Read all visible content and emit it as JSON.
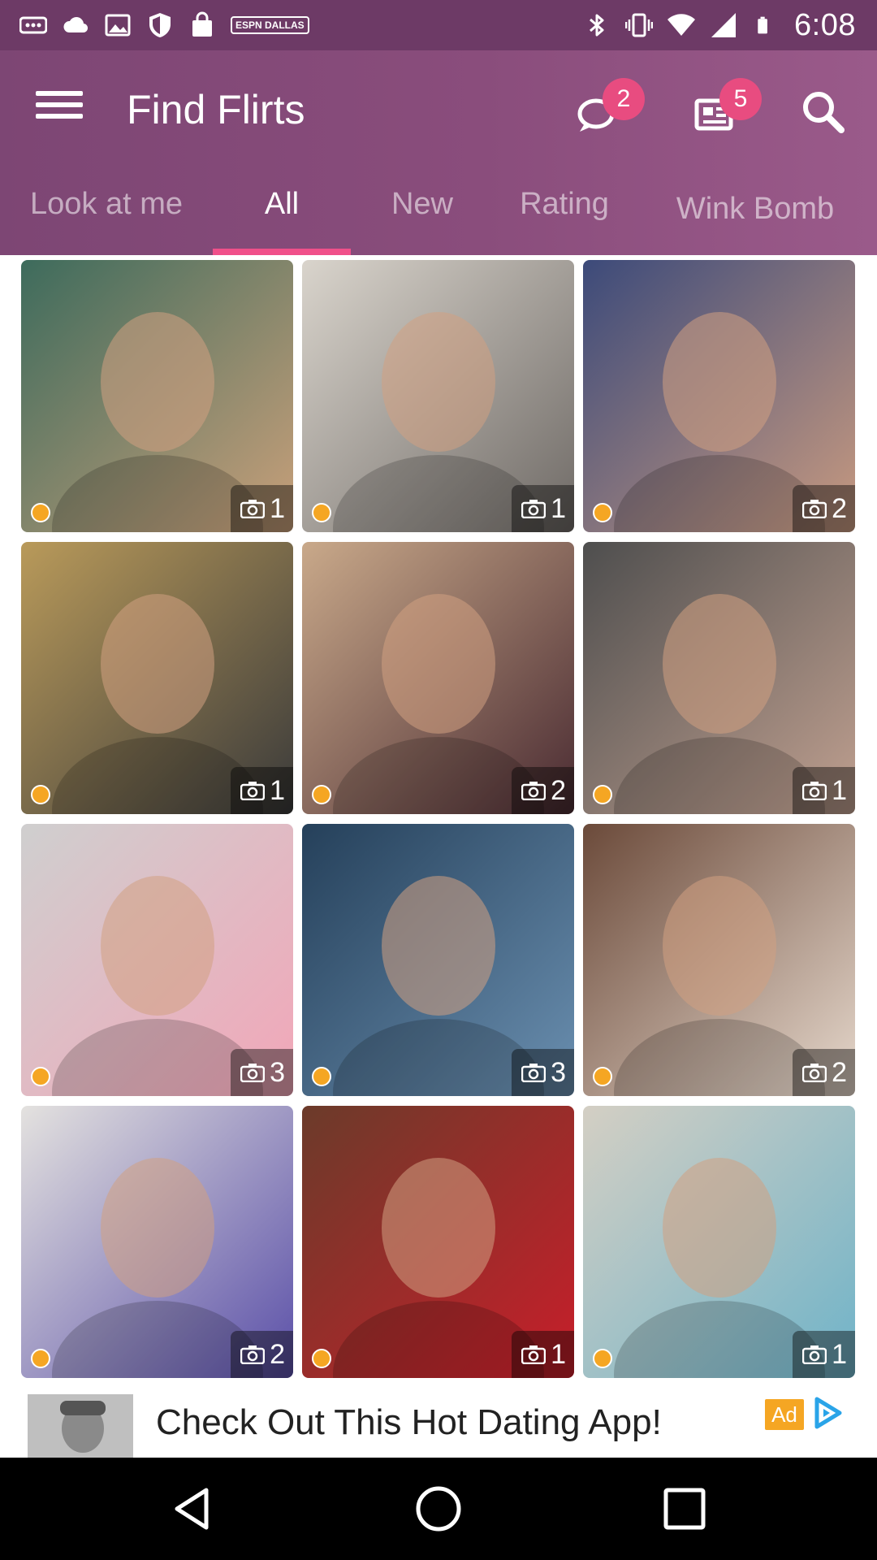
{
  "status_bar": {
    "time": "6:08",
    "left_icons": [
      "notification-dots-icon",
      "cloud-icon",
      "image-icon",
      "shield-icon",
      "shopping-bag-icon",
      "espn-icon"
    ],
    "espn_badge_text": "ESPN DALLAS",
    "right_icons": [
      "bluetooth-icon",
      "vibrate-icon",
      "wifi-icon",
      "signal-icon",
      "battery-icon"
    ]
  },
  "app_bar": {
    "title": "Find Flirts",
    "messages_badge": "2",
    "news_badge": "5",
    "icons": [
      "menu-icon",
      "chat-bubble-icon",
      "newspaper-icon",
      "search-icon"
    ]
  },
  "tabs": [
    {
      "label": "Look at me",
      "active": false
    },
    {
      "label": "All",
      "active": true
    },
    {
      "label": "New",
      "active": false
    },
    {
      "label": "Rating",
      "active": false
    },
    {
      "label": "Wink Bomb",
      "active": false
    }
  ],
  "profiles": [
    {
      "photos": "1",
      "online": true,
      "bg": [
        "#3d6b5c",
        "#c9a07a"
      ]
    },
    {
      "photos": "1",
      "online": true,
      "bg": [
        "#d9d4cc",
        "#6f6a66"
      ]
    },
    {
      "photos": "2",
      "online": true,
      "bg": [
        "#3c4a7a",
        "#c89a80"
      ]
    },
    {
      "photos": "1",
      "online": true,
      "bg": [
        "#b99a5a",
        "#3a3a3a"
      ]
    },
    {
      "photos": "2",
      "online": true,
      "bg": [
        "#c9a98a",
        "#4a2b32"
      ]
    },
    {
      "photos": "1",
      "online": true,
      "bg": [
        "#4e4e4e",
        "#c0a090"
      ]
    },
    {
      "photos": "3",
      "online": true,
      "bg": [
        "#cfcfcf",
        "#f2a6b8"
      ]
    },
    {
      "photos": "3",
      "online": true,
      "bg": [
        "#25405a",
        "#6a8fb0"
      ]
    },
    {
      "photos": "2",
      "online": true,
      "bg": [
        "#6b4a3a",
        "#e6d8cc"
      ]
    },
    {
      "photos": "2",
      "online": true,
      "bg": [
        "#e4e2df",
        "#5a4fa8"
      ]
    },
    {
      "photos": "1",
      "online": true,
      "bg": [
        "#6b3b2a",
        "#c81e2a"
      ]
    },
    {
      "photos": "1",
      "online": true,
      "bg": [
        "#d4cfc4",
        "#6fb3c8"
      ]
    }
  ],
  "ad": {
    "text": "Check Out This Hot Dating App!",
    "label": "Ad"
  },
  "colors": {
    "status_bar": "#6d3a66",
    "app_bar": "#8a4d7c",
    "tab_indicator": "#f0508a",
    "badge": "#e84c80",
    "online_dot": "#f5a623"
  }
}
